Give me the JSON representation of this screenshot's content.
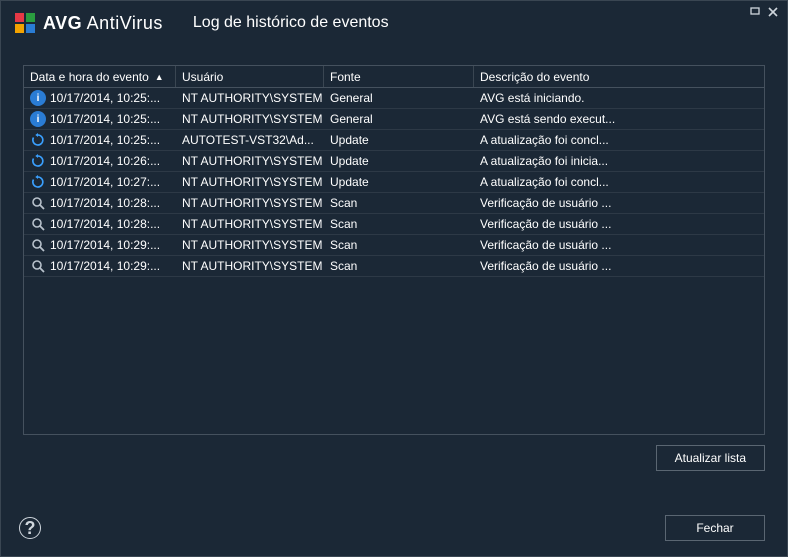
{
  "app": {
    "brand_bold": "AVG",
    "brand_light": " AntiVirus",
    "page_title": "Log de histórico de eventos"
  },
  "columns": {
    "date": "Data e hora do evento",
    "user": "Usuário",
    "source": "Fonte",
    "desc": "Descrição do evento"
  },
  "rows": [
    {
      "icon": "info",
      "date": "10/17/2014, 10:25:...",
      "user": "NT AUTHORITY\\SYSTEM",
      "source": "General",
      "desc": "AVG está iniciando."
    },
    {
      "icon": "info",
      "date": "10/17/2014, 10:25:...",
      "user": "NT AUTHORITY\\SYSTEM",
      "source": "General",
      "desc": "AVG está sendo execut..."
    },
    {
      "icon": "update",
      "date": "10/17/2014, 10:25:...",
      "user": "AUTOTEST-VST32\\Ad...",
      "source": "Update",
      "desc": "A atualização foi concl..."
    },
    {
      "icon": "update",
      "date": "10/17/2014, 10:26:...",
      "user": "NT AUTHORITY\\SYSTEM",
      "source": "Update",
      "desc": "A atualização foi inicia..."
    },
    {
      "icon": "update",
      "date": "10/17/2014, 10:27:...",
      "user": "NT AUTHORITY\\SYSTEM",
      "source": "Update",
      "desc": "A atualização foi concl..."
    },
    {
      "icon": "scan",
      "date": "10/17/2014, 10:28:...",
      "user": "NT AUTHORITY\\SYSTEM",
      "source": "Scan",
      "desc": "Verificação de usuário ..."
    },
    {
      "icon": "scan",
      "date": "10/17/2014, 10:28:...",
      "user": "NT AUTHORITY\\SYSTEM",
      "source": "Scan",
      "desc": "Verificação de usuário ..."
    },
    {
      "icon": "scan",
      "date": "10/17/2014, 10:29:...",
      "user": "NT AUTHORITY\\SYSTEM",
      "source": "Scan",
      "desc": "Verificação de usuário ..."
    },
    {
      "icon": "scan",
      "date": "10/17/2014, 10:29:...",
      "user": "NT AUTHORITY\\SYSTEM",
      "source": "Scan",
      "desc": "Verificação de usuário ..."
    }
  ],
  "buttons": {
    "refresh": "Atualizar lista",
    "close": "Fechar"
  }
}
